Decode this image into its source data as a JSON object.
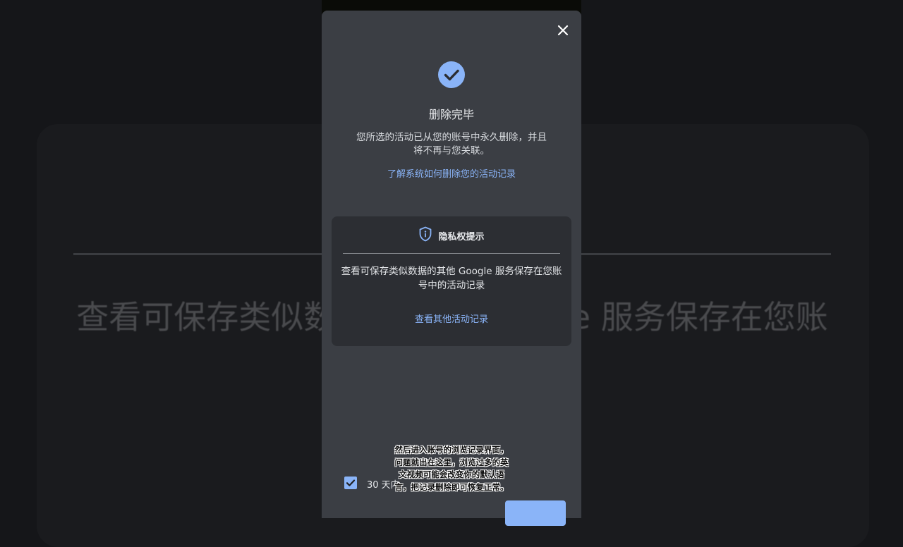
{
  "background": {
    "blurred_text": "查看可保存类似数据的其他 Google 服务保存在您账号中的活动记录"
  },
  "dialog": {
    "close_icon": "close-icon",
    "status_icon": "check-circle-icon",
    "title": "删除完毕",
    "description": "您所选的活动已从您的账号中永久删除，并且将不再与您关联。",
    "learn_link": "了解系统如何删除您的活动记录",
    "privacy_card": {
      "icon": "shield-info-icon",
      "title": "隐私权提示",
      "description": "查看可保存类似数据的其他 Google 服务保存在您账号中的活动记录",
      "link": "查看其他活动记录"
    },
    "checkbox": {
      "checked": true,
      "label": "30 天内"
    }
  },
  "caption": "然后进入账号的浏览记录界面，问题就出在这里，浏览过多的英文视频可能会改变你的默认语言，把记录删除即可恢复正常。",
  "colors": {
    "accent": "#8ab4f8",
    "dialog_bg": "#3b3e44",
    "card_bg": "#2c2e33",
    "page_bg": "#151619"
  }
}
